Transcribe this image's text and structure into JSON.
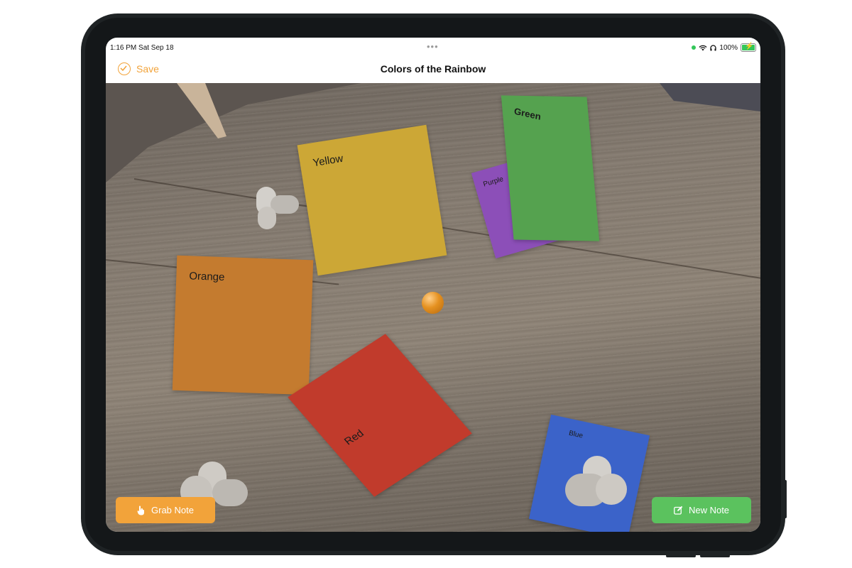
{
  "status_bar": {
    "time": "1:16 PM  Sat Sep 18",
    "dots": "•••",
    "battery": "100%"
  },
  "nav": {
    "save_label": "Save",
    "title": "Colors of the Rainbow"
  },
  "notes": [
    {
      "id": "yellow",
      "label": "Yellow",
      "color": "#cca736"
    },
    {
      "id": "purple",
      "label": "Purple",
      "color": "#8c4fb8"
    },
    {
      "id": "green",
      "label": "Green",
      "color": "#55a24f"
    },
    {
      "id": "orange",
      "label": "Orange",
      "color": "#c47b2f"
    },
    {
      "id": "red",
      "label": "Red",
      "color": "#c13b2c"
    },
    {
      "id": "blue",
      "label": "Blue",
      "color": "#3b63c9"
    }
  ],
  "buttons": {
    "grab_note": "Grab Note",
    "new_note": "New Note"
  },
  "colors": {
    "accent_orange": "#f2a33a",
    "accent_green": "#5bc25e"
  },
  "icons": {
    "save": "checkmark-circle-icon",
    "grab": "hand-pointing-icon",
    "new": "compose-icon"
  }
}
